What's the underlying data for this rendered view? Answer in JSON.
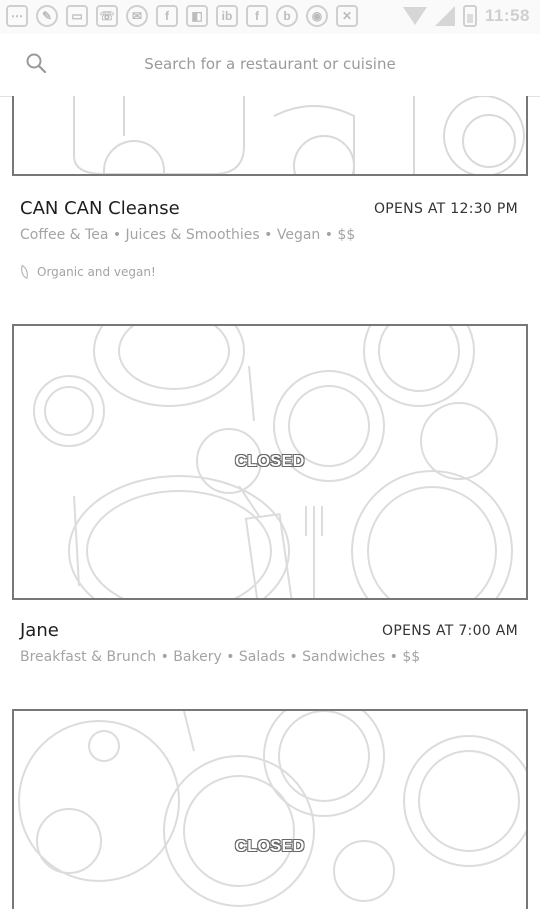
{
  "status_bar": {
    "time": "11:58",
    "left_icons": [
      "chat-icon",
      "wrench-icon",
      "message-icon",
      "phone-icon",
      "mail-icon",
      "facebook-icon",
      "app-icon",
      "ib-icon",
      "facebook-icon",
      "b-icon",
      "media-icon",
      "tool-icon"
    ],
    "right_icons": [
      "wifi-icon",
      "signal-icon",
      "battery-icon"
    ]
  },
  "search": {
    "placeholder": "Search for a restaurant or cuisine"
  },
  "restaurants": [
    {
      "name": "CAN CAN Cleanse",
      "hours": "OPENS AT 12:30 PM",
      "tags": "Coffee & Tea • Juices & Smoothies • Vegan • $$",
      "note": "Organic and vegan!",
      "status": ""
    },
    {
      "name": "Jane",
      "hours": "OPENS AT 7:00 AM",
      "tags": "Breakfast & Brunch • Bakery • Salads • Sandwiches • $$",
      "status": "CLOSED"
    },
    {
      "name": "",
      "hours": "",
      "tags": "",
      "status": "CLOSED"
    }
  ]
}
